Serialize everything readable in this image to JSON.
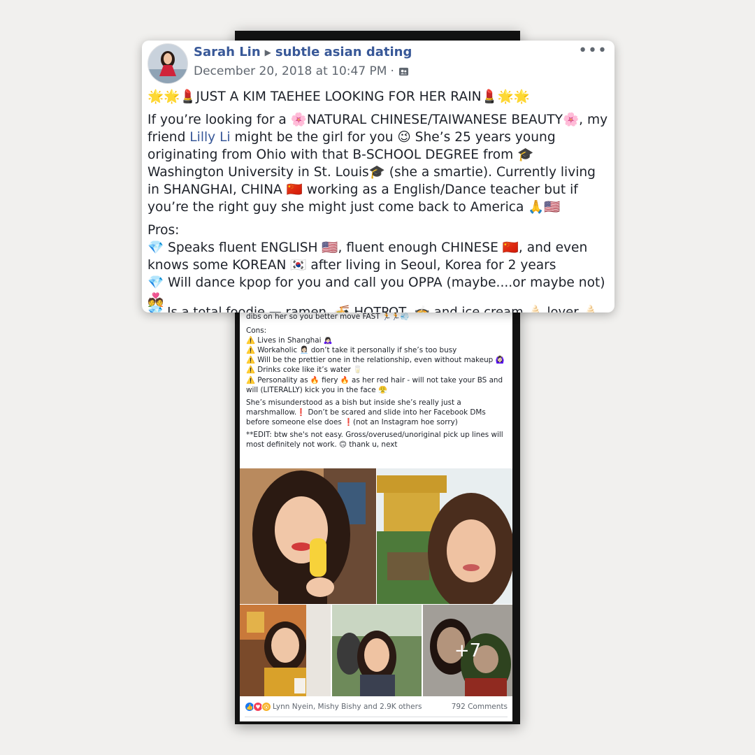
{
  "post": {
    "author": "Sarah Lin",
    "arrow": "▶",
    "group": "subtle asian dating",
    "date": "December 20, 2018 at 10:47 PM",
    "dot": "·",
    "more": "•••",
    "headline": "🌟🌟💄JUST A KIM TAEHEE LOOKING FOR HER RAIN💄🌟🌟",
    "intro_a": "If you’re looking for a 🌸NATURAL CHINESE/TAIWANESE BEAUTY🌸, my friend ",
    "friend": "Lilly Li",
    "intro_b": " might be the girl for you 😉 She’s 25 years young originating from Ohio with that B-SCHOOL DEGREE from 🎓 Washington University in St. Louis🎓 (she a smartie). Currently living in SHANGHAI, CHINA 🇨🇳 working as a English/Dance teacher but if you’re the right guy she might just come back to America 🙏🇺🇸",
    "pros_label": "Pros:",
    "pros_1": "💎 Speaks fluent ENGLISH 🇺🇸, fluent enough CHINESE 🇨🇳, and even knows some KOREAN 🇰🇷 after living in Seoul, Korea for 2 years",
    "pros_2": "💎 Will dance kpop for you and call you OPPA (maybe....or maybe not) 💑",
    "cut_off": "💎 Is a total foodie — ramen, 🍜 HOTPOT, 🍲 and ice cream 🍦 lover 🍦 ..."
  },
  "background_post": {
    "line_dibs": "dibs on her so you better move FAST 🏃🏃💨",
    "cons_label": "Cons:",
    "cons_1": "⚠️ Lives in Shanghai 🙇🏻‍♀️",
    "cons_2": "⚠️ Workaholic 👩🏻‍💼 don’t take it personally if she’s too busy",
    "cons_3": "⚠️ Will be the prettier one in the relationship, even without makeup 🙆🏻‍♀️",
    "cons_4": "⚠️ Drinks coke like it’s water 🥛",
    "cons_5": "⚠️ Personality as 🔥 fiery 🔥 as her red hair - will not take your BS and will (LITERALLY) kick you in the face 😤",
    "para_1": "She’s misunderstood as a bish but inside she’s really just a marshmallow.❗ Don’t be scared and slide into her Facebook DMs before someone else does ❗(not an Instagram hoe sorry)",
    "para_2": "**EDIT: btw she's not easy. Gross/overused/unoriginal pick up lines will most definitely not work. 🙃 thank u, next",
    "more_photos": "+7",
    "reactors": "Lynn Nyein, Mishy Bishy and 2.9K others",
    "comments": "792 Comments"
  },
  "colors": {
    "link": "#385898",
    "secondary": "#606770",
    "like": "#1877f2",
    "love": "#f33e58",
    "wow": "#f7b125"
  }
}
